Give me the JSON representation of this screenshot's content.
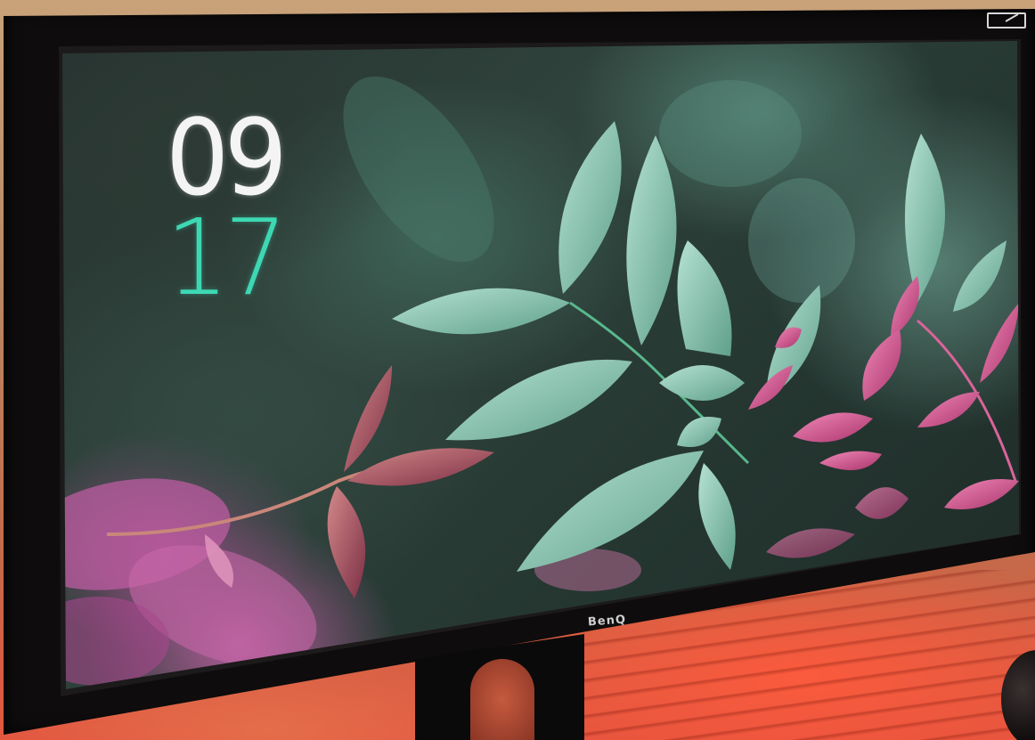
{
  "clock": {
    "hours": "09",
    "minutes": "17"
  },
  "monitor": {
    "brand": "BenQ"
  },
  "colors": {
    "hours_color": "#f4f4f4",
    "minutes_color": "#3dd8b3",
    "leaf_green": "#8fc7b3",
    "leaf_pink": "#d9649a"
  }
}
